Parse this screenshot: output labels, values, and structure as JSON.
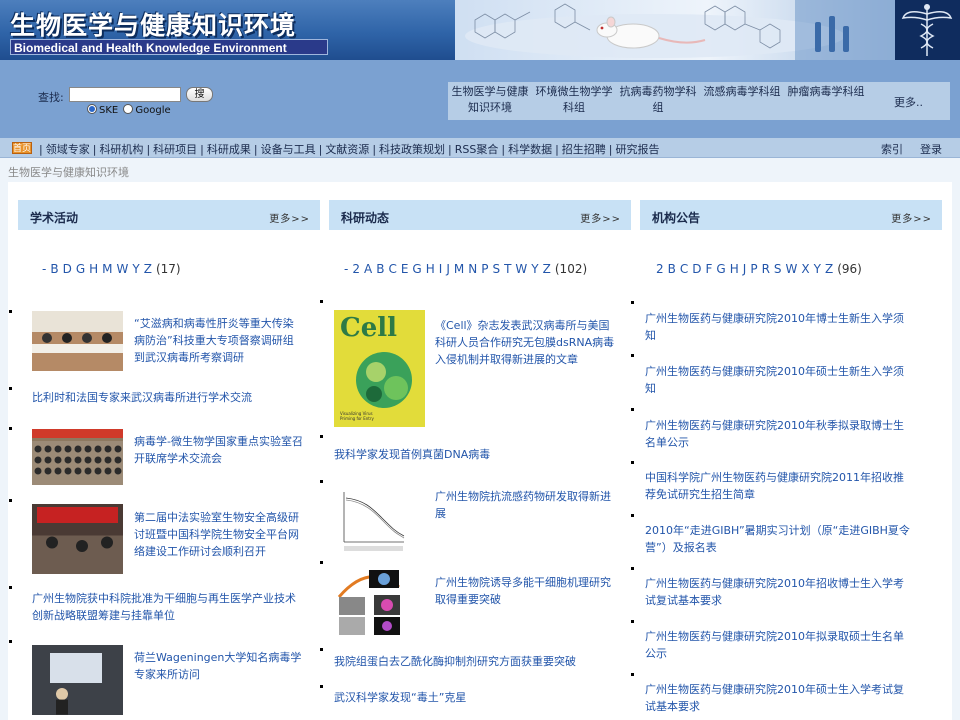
{
  "header": {
    "title_cn": "生物医学与健康知识环境",
    "title_en": "Biomedical and Health Knowledge Environment"
  },
  "search": {
    "label": "查找:",
    "value": "",
    "button": "搜",
    "options": [
      "SKE",
      "Google"
    ],
    "selected": "SKE"
  },
  "sites": [
    {
      "label": "生物医学与健康知识环境"
    },
    {
      "label": "环境微生物学学科组"
    },
    {
      "label": "抗病毒药物学科组"
    },
    {
      "label": "流感病毒学科组"
    },
    {
      "label": "肿瘤病毒学科组"
    }
  ],
  "sites_more": "更多..",
  "nav": {
    "home": "首页",
    "items": [
      "领域专家",
      "科研机构",
      "科研项目",
      "科研成果",
      "设备与工具",
      "文献资源",
      "科技政策规划",
      "RSS聚合",
      "科学数据",
      "招生招聘",
      "研究报告"
    ],
    "index": "索引",
    "login": "登录"
  },
  "breadcrumb": "生物医学与健康知识环境",
  "columns": [
    {
      "title": "学术活动",
      "more": "更多>>",
      "letters": [
        "-",
        "B",
        "D",
        "G",
        "H",
        "M",
        "W",
        "Y",
        "Z"
      ],
      "count": "(17)",
      "items": [
        {
          "text": "“艾滋病和病毒性肝炎等重大传染病防治”科技重大专项督察调研组到武汉病毒所考察调研",
          "has_image": true
        },
        {
          "text": "比利时和法国专家来武汉病毒所进行学术交流",
          "has_image": false
        },
        {
          "text": "病毒学-微生物学国家重点实验室召开联席学术交流会",
          "has_image": true
        },
        {
          "text": "第二届中法实验室生物安全高级研讨班暨中国科学院生物安全平台网络建设工作研讨会顺利召开",
          "has_image": true
        },
        {
          "text": "广州生物院获中科院批准为干细胞与再生医学产业技术创新战略联盟筹建与挂靠单位",
          "has_image": false
        },
        {
          "text": "荷兰Wageningen大学知名病毒学专家来所访问",
          "has_image": true
        }
      ]
    },
    {
      "title": "科研动态",
      "more": "更多>>",
      "letters": [
        "-",
        "2",
        "A",
        "B",
        "C",
        "E",
        "G",
        "H",
        "I",
        "J",
        "M",
        "N",
        "P",
        "S",
        "T",
        "W",
        "Y",
        "Z"
      ],
      "count": "(102)",
      "items": [
        {
          "text": "《Cell》杂志发表武汉病毒所与美国科研人员合作研究无包膜dsRNA病毒入侵机制并取得新进展的文章",
          "has_image": true
        },
        {
          "text": "我科学家发现首例真菌DNA病毒",
          "has_image": false
        },
        {
          "text": "广州生物院抗流感药物研发取得新进展",
          "has_image": true
        },
        {
          "text": "广州生物院诱导多能干细胞机理研究取得重要突破",
          "has_image": true
        },
        {
          "text": "我院组蛋白去乙酰化酶抑制剂研究方面获重要突破",
          "has_image": false
        },
        {
          "text": "武汉科学家发现“毒土”克星",
          "has_image": false
        }
      ],
      "cell_cover": {
        "title": "Cell",
        "caption": "Visualizing Virus Priming for Entry"
      }
    },
    {
      "title": "机构公告",
      "more": "更多>>",
      "letters": [
        "2",
        "B",
        "C",
        "D",
        "F",
        "G",
        "H",
        "J",
        "P",
        "R",
        "S",
        "W",
        "X",
        "Y",
        "Z"
      ],
      "count": "(96)",
      "items": [
        {
          "text": "广州生物医药与健康研究院2010年博士生新生入学须知"
        },
        {
          "text": "广州生物医药与健康研究院2010年硕士生新生入学须知"
        },
        {
          "text": "广州生物医药与健康研究院2010年秋季拟录取博士生名单公示"
        },
        {
          "text": "中国科学院广州生物医药与健康研究院2011年招收推荐免试研究生招生简章"
        },
        {
          "text": "2010年“走进GIBH”暑期实习计划（原“走进GIBH夏令营”）及报名表"
        },
        {
          "text": "广州生物医药与健康研究院2010年招收博士生入学考试复试基本要求"
        },
        {
          "text": "广州生物医药与健康研究院2010年拟录取硕士生名单公示"
        },
        {
          "text": "广州生物医药与健康研究院2010年硕士生入学考试复试基本要求"
        }
      ]
    }
  ],
  "colors": {
    "banner": "#2f64a8",
    "topbar": "#7ba1d1",
    "nav": "#b6cde6",
    "panel_head": "#c8e1f5",
    "link": "#2255aa"
  }
}
